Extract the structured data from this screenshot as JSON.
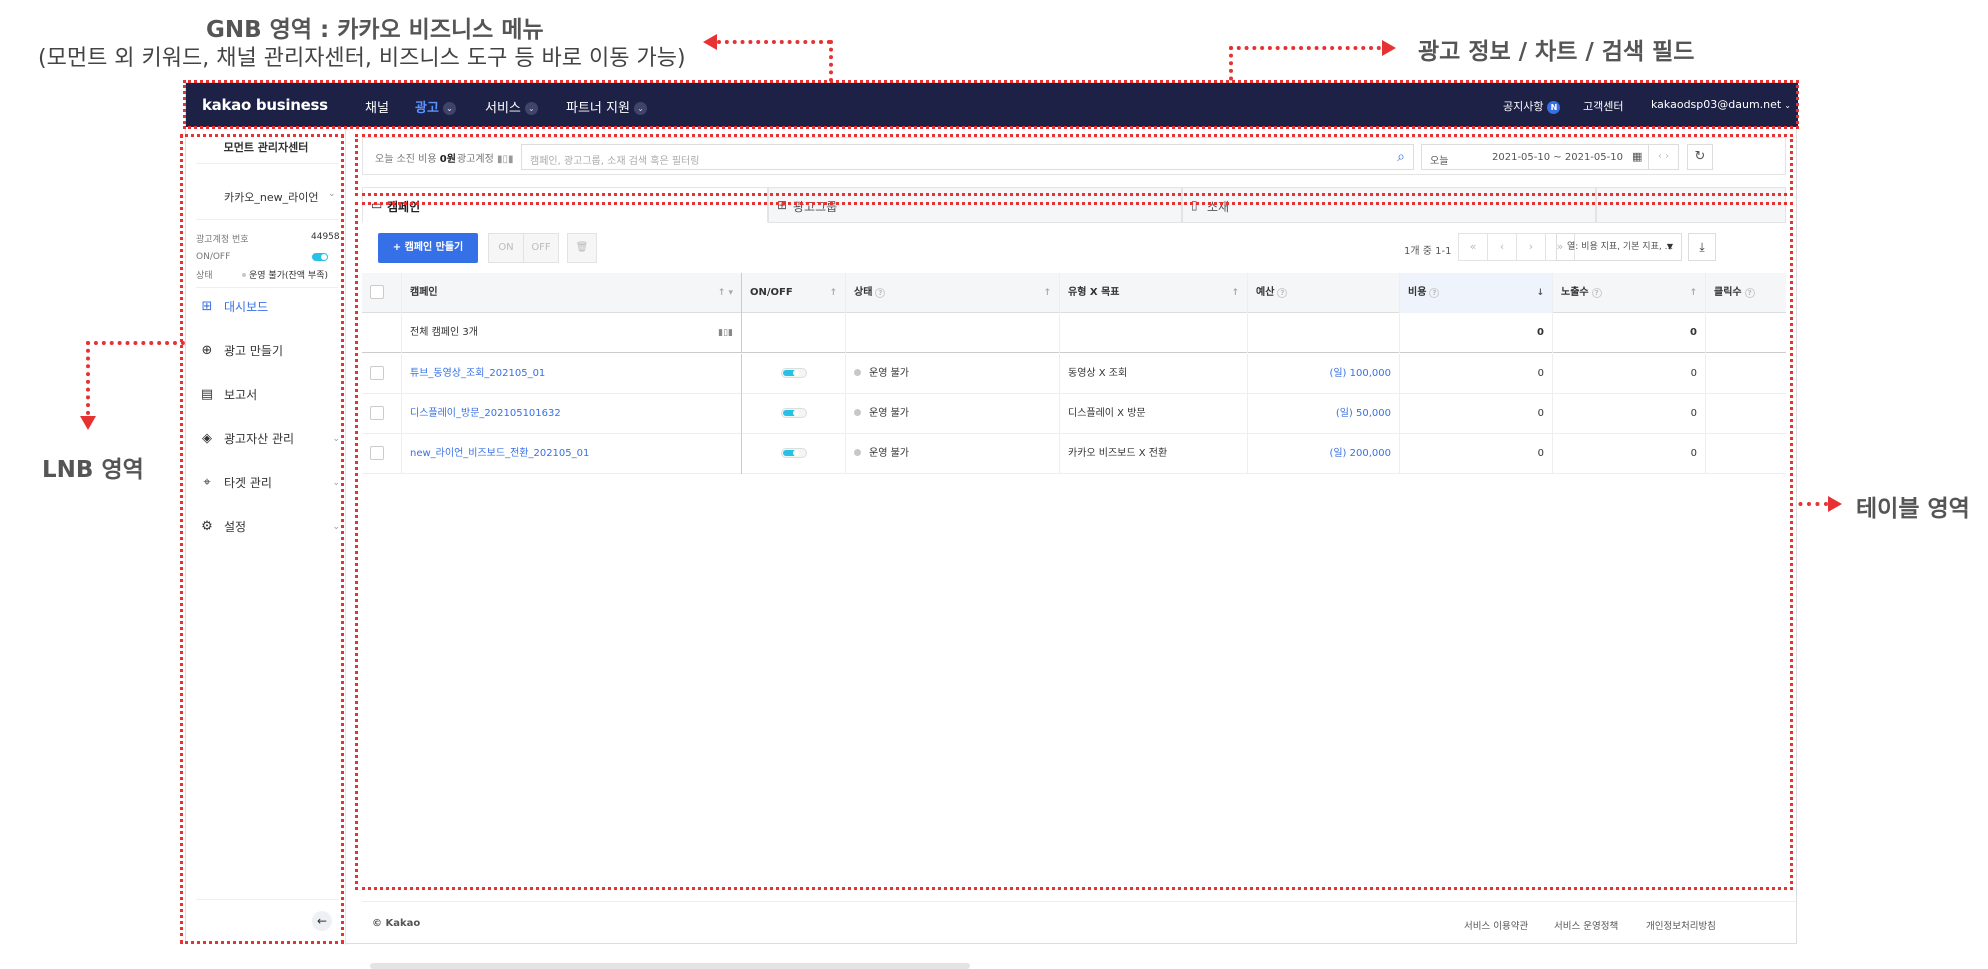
{
  "annotations": {
    "gnb_title": "GNB 영역 : 카카오 비즈니스 메뉴",
    "gnb_sub": "(모먼트 외 키워드, 채널 관리자센터, 비즈니스 도구 등 바로 이동 가능)",
    "ad_info": "광고 정보 / 차트 / 검색 필드",
    "lnb": "LNB 영역",
    "table": "테이블 영역",
    "marker_color": "#e63232"
  },
  "gnb": {
    "logo": "kakao business",
    "menu": [
      "채널",
      "광고",
      "서비스",
      "파트너 지원"
    ],
    "active_menu": "광고",
    "notice": "공지사항",
    "notice_badge": "N",
    "support": "고객센터",
    "account": "kakaodsp03@daum.net",
    "bg_color": "#1c2145"
  },
  "lnb": {
    "center_title": "모먼트 관리자센터",
    "account_name": "카카오_new_라이언",
    "account_no_label": "광고계정 번호",
    "account_no": "44958",
    "onoff_label": "ON/OFF",
    "status_label": "상태",
    "status_value": "운영 불가(잔액 부족)",
    "nav": [
      {
        "label": "대시보드",
        "icon": "dashboard-icon",
        "active": true
      },
      {
        "label": "광고 만들기",
        "icon": "plus-circle-icon"
      },
      {
        "label": "보고서",
        "icon": "report-icon"
      },
      {
        "label": "광고자산 관리",
        "icon": "layers-icon",
        "expandable": true
      },
      {
        "label": "타겟 관리",
        "icon": "target-icon",
        "expandable": true
      },
      {
        "label": "설정",
        "icon": "gear-icon",
        "expandable": true
      }
    ]
  },
  "topbar": {
    "today_spend_label": "오늘 소진 비용",
    "today_spend_value": "0원",
    "ad_account_label": "광고계정",
    "search_placeholder": "캠페인, 광고그룹, 소재 검색 혹은 필터링",
    "date_preset": "오늘",
    "date_range": "2021-05-10 ~ 2021-05-10"
  },
  "tabs": [
    {
      "label": "캠페인",
      "icon": "folder-icon",
      "active": true
    },
    {
      "label": "광고그룹",
      "icon": "grid-icon"
    },
    {
      "label": "소재",
      "icon": "file-icon"
    }
  ],
  "toolbar": {
    "create_label": "+ 캠페인 만들기",
    "on_label": "ON",
    "off_label": "OFF",
    "pager_text": "1개 중 1-1",
    "column_select": "열: 비용 지표, 기본 지표, ..."
  },
  "table": {
    "headers": [
      "캠페인",
      "ON/OFF",
      "상태",
      "유형 X 목표",
      "예산",
      "비용",
      "노출수",
      "클릭수"
    ],
    "total_label": "전체 캠페인 3개",
    "total_cost": "0",
    "total_impressions": "0",
    "rows": [
      {
        "name": "튜브_동영상_조회_202105_01",
        "status": "운영 불가",
        "type_goal": "동영상 X 조회",
        "budget": "(일) 100,000",
        "cost": "0",
        "impressions": "0"
      },
      {
        "name": "디스플레이_방문_202105101632",
        "status": "운영 불가",
        "type_goal": "디스플레이 X 방문",
        "budget": "(일) 50,000",
        "cost": "0",
        "impressions": "0"
      },
      {
        "name": "new_라이언_비즈보드_전환_202105_01",
        "status": "운영 불가",
        "type_goal": "카카오 비즈보드 X 전환",
        "budget": "(일) 200,000",
        "cost": "0",
        "impressions": "0"
      }
    ]
  },
  "footer": {
    "copyright": "© Kakao",
    "links": [
      "서비스 이용약관",
      "서비스 운영정책",
      "개인정보처리방침"
    ]
  }
}
